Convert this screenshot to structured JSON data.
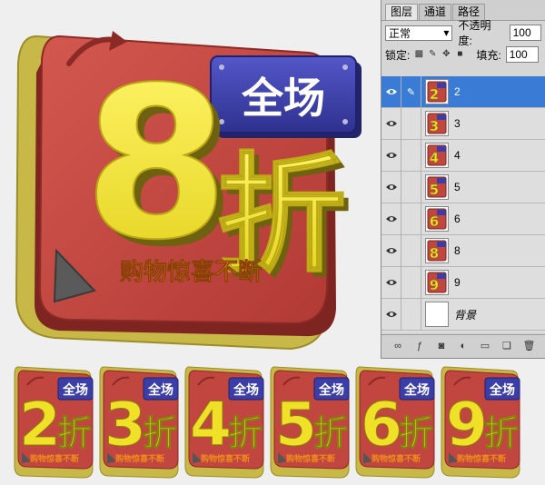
{
  "badge": {
    "number": "8",
    "word_all": "全场",
    "word_discount": "折",
    "slogan": "购物惊喜不断"
  },
  "thumbnails": [
    {
      "number": "2",
      "word_all": "全场",
      "word_discount": "折",
      "slogan": "购物惊喜不断"
    },
    {
      "number": "3",
      "word_all": "全场",
      "word_discount": "折",
      "slogan": "购物惊喜不断"
    },
    {
      "number": "4",
      "word_all": "全场",
      "word_discount": "折",
      "slogan": "购物惊喜不断"
    },
    {
      "number": "5",
      "word_all": "全场",
      "word_discount": "折",
      "slogan": "购物惊喜不断"
    },
    {
      "number": "6",
      "word_all": "全场",
      "word_discount": "折",
      "slogan": "购物惊喜不断"
    },
    {
      "number": "9",
      "word_all": "全场",
      "word_discount": "折",
      "slogan": "购物惊喜不断"
    }
  ],
  "panel": {
    "tabs": [
      {
        "label": "图层",
        "active": true
      },
      {
        "label": "通道",
        "active": false
      },
      {
        "label": "路径",
        "active": false
      }
    ],
    "blend_mode": "正常",
    "opacity_label": "不透明度:",
    "opacity_value": "100",
    "lock_label": "锁定:",
    "fill_label": "填充:",
    "fill_value": "100",
    "layers": [
      {
        "name": "2",
        "thumb_number": "2",
        "selected": true
      },
      {
        "name": "3",
        "thumb_number": "3",
        "selected": false
      },
      {
        "name": "4",
        "thumb_number": "4",
        "selected": false
      },
      {
        "name": "5",
        "thumb_number": "5",
        "selected": false
      },
      {
        "name": "6",
        "thumb_number": "6",
        "selected": false
      },
      {
        "name": "8",
        "thumb_number": "8",
        "selected": false
      },
      {
        "name": "9",
        "thumb_number": "9",
        "selected": false
      },
      {
        "name": "背景",
        "thumb_number": "",
        "selected": false
      }
    ]
  },
  "colors": {
    "badge_red": "#c0463f",
    "badge_dark_red": "#7e2522",
    "back_yellow": "#c8b545",
    "number_yellow": "#f0e028",
    "label_blue": "#3b3ea6",
    "slogan_orange": "#f08a1c",
    "selection_blue": "#3a7bd5"
  }
}
